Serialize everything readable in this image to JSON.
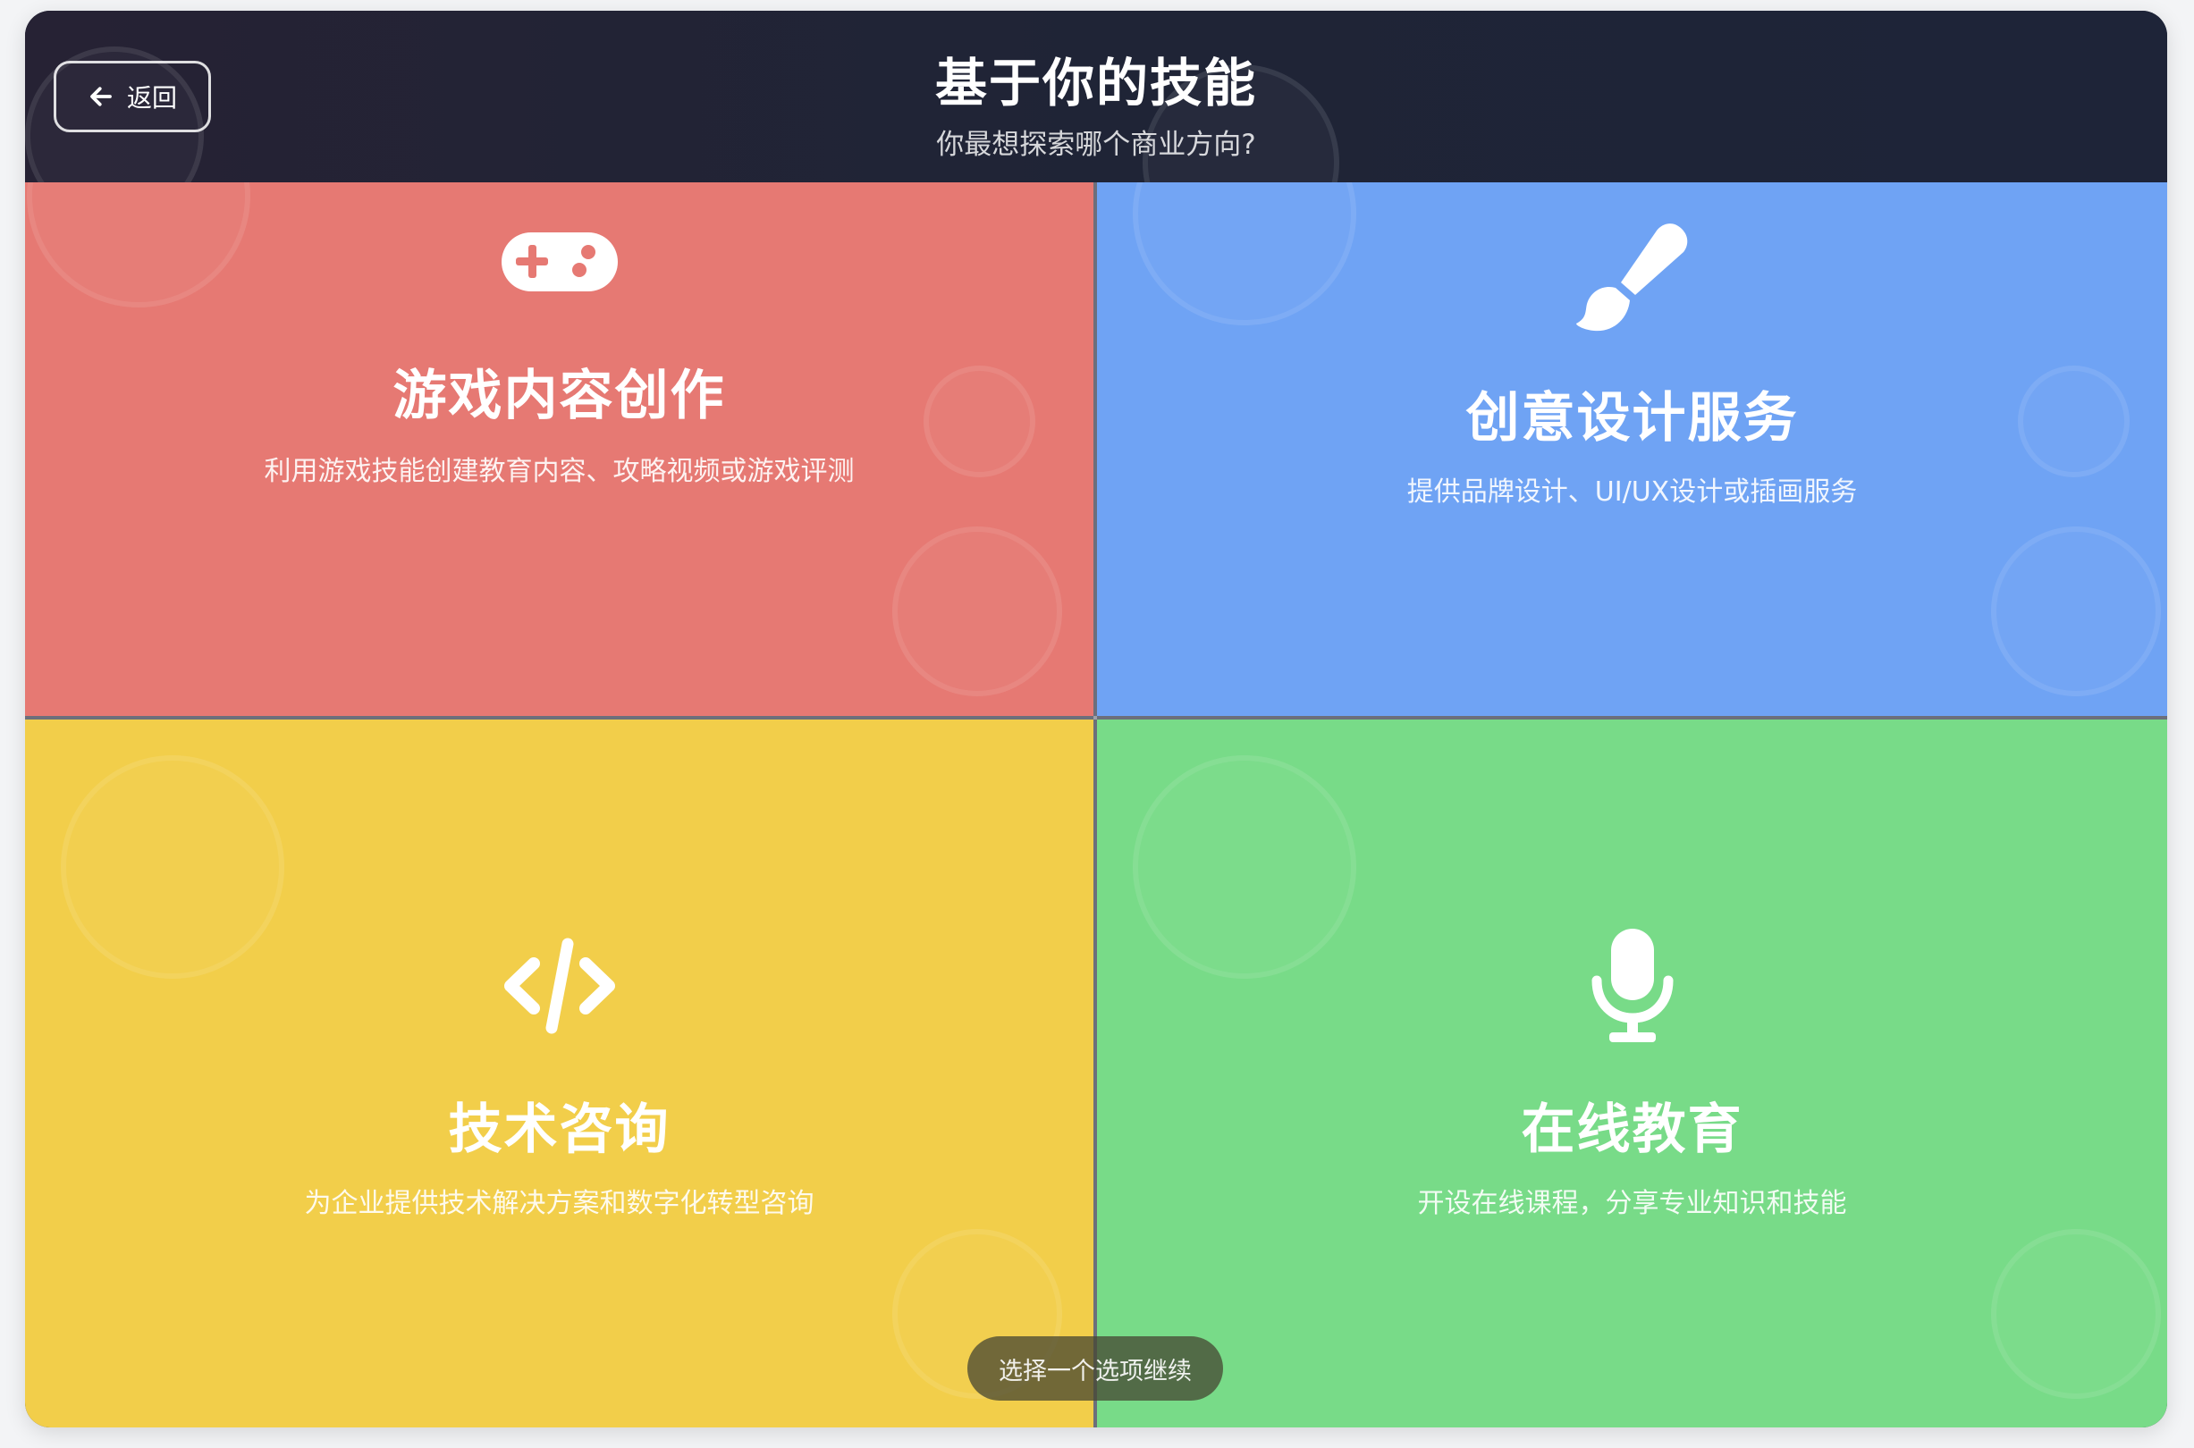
{
  "header": {
    "back_label": "返回",
    "title": "基于你的技能",
    "subtitle": "你最想探索哪个商业方向?"
  },
  "options": [
    {
      "id": "game",
      "title": "游戏内容创作",
      "desc": "利用游戏技能创建教育内容、攻略视频或游戏评测",
      "icon": "gamepad-icon",
      "color": "#e67973"
    },
    {
      "id": "design",
      "title": "创意设计服务",
      "desc": "提供品牌设计、UI/UX设计或插画服务",
      "icon": "paintbrush-icon",
      "color": "#6fa3f4"
    },
    {
      "id": "tech",
      "title": "技术咨询",
      "desc": "为企业提供技术解决方案和数字化转型咨询",
      "icon": "code-icon",
      "color": "#f2ce4a"
    },
    {
      "id": "edu",
      "title": "在线教育",
      "desc": "开设在线课程，分享专业知识和技能",
      "icon": "microphone-icon",
      "color": "#78db88"
    }
  ],
  "footer": {
    "hint": "选择一个选项继续"
  }
}
